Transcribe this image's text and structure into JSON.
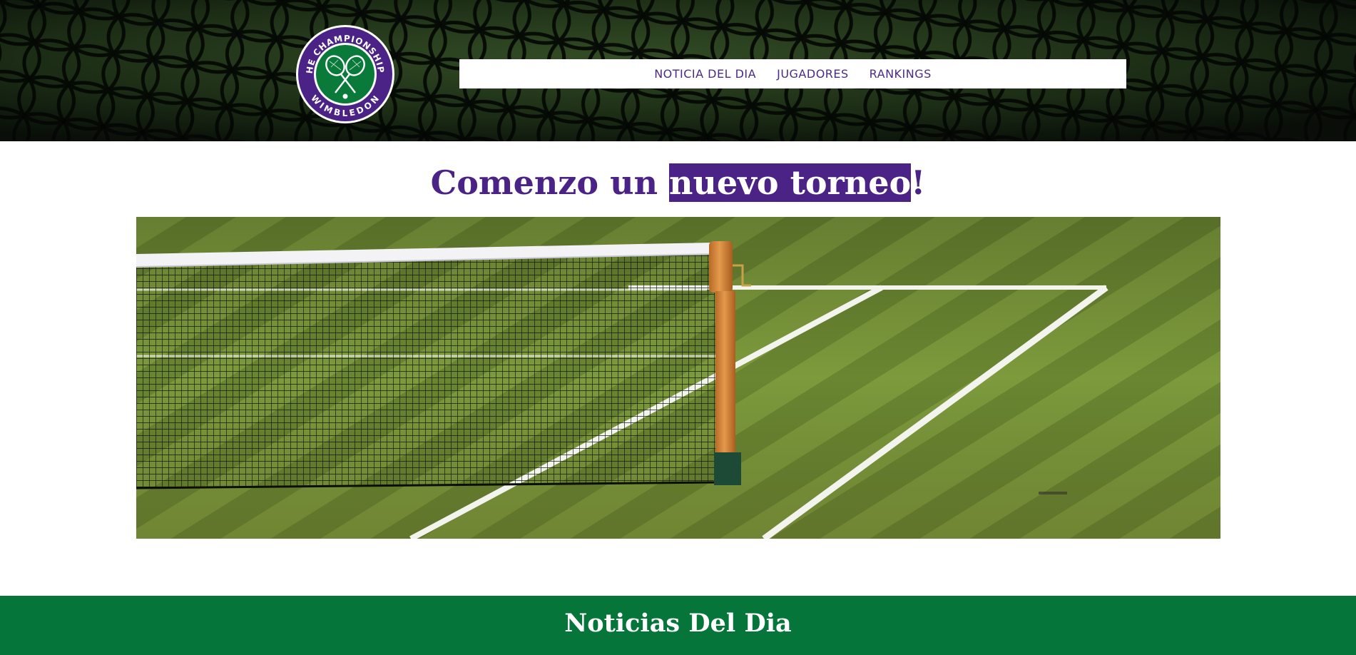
{
  "header": {
    "logo": {
      "top_text": "THE CHAMPIONSHIPS",
      "bottom_text": "WIMBLEDON",
      "ring_color": "#4b2386",
      "center_color": "#0a7a3b"
    },
    "nav": [
      {
        "label": "NOTICIA DEL DIA"
      },
      {
        "label": "JUGADORES"
      },
      {
        "label": "RANKINGS"
      }
    ]
  },
  "hero": {
    "title_before": "Comenzo un ",
    "title_highlight": "nuevo torneo",
    "title_after": "!",
    "image_icon": "tennis-net-court-image"
  },
  "news": {
    "title": "Noticias Del Dia"
  },
  "colors": {
    "purple": "#4b2386",
    "green": "#05753a",
    "nav_text": "#4b2a86"
  }
}
